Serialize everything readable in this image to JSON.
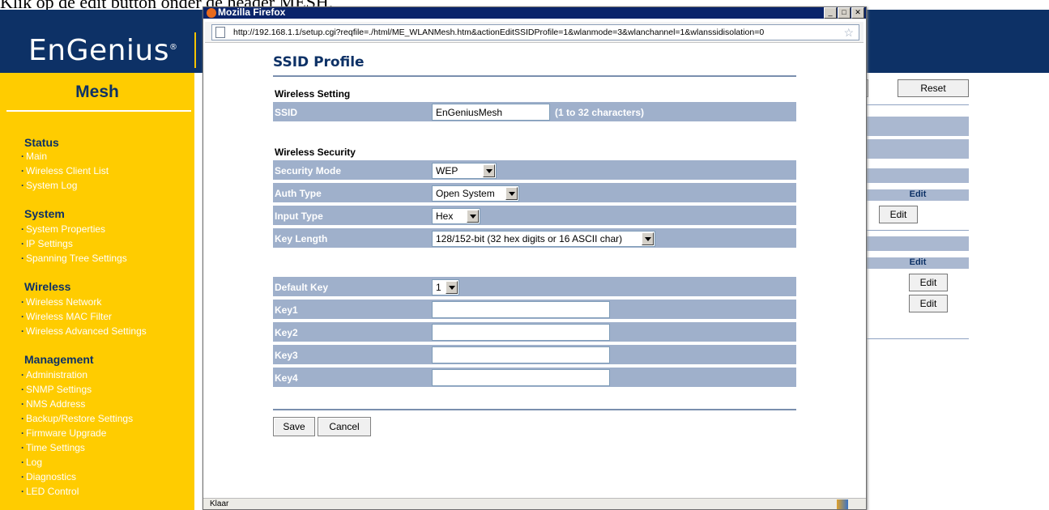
{
  "doc_caption": "Klik op de edit button onder de header MESH.",
  "router": {
    "logo": "EnGenius",
    "logo_mark": "®",
    "sidebar_title": "Mesh",
    "sections": [
      {
        "title": "Status",
        "items": [
          "Main",
          "Wireless Client List",
          "System Log"
        ]
      },
      {
        "title": "System",
        "items": [
          "System Properties",
          "IP Settings",
          "Spanning Tree Settings"
        ]
      },
      {
        "title": "Wireless",
        "items": [
          "Wireless Network",
          "Wireless MAC Filter",
          "Wireless Advanced Settings"
        ]
      },
      {
        "title": "Management",
        "items": [
          "Administration",
          "SNMP Settings",
          "NMS Address",
          "Backup/Restore Settings",
          "Firmware Upgrade",
          "Time Settings",
          "Log",
          "Diagnostics",
          "LED Control"
        ]
      }
    ],
    "bg": {
      "reset_label": "Reset",
      "edit_head_1": "Edit",
      "edit_btn_1": "Edit",
      "edit_head_2": "Edit",
      "edit_btn_2": "Edit",
      "edit_btn_3": "Edit"
    }
  },
  "popup": {
    "window_title": "Mozilla Firefox",
    "url": "http://192.168.1.1/setup.cgi?reqfile=./html/ME_WLANMesh.htm&actionEditSSIDProfile=1&wlanmode=3&wlanchannel=1&wlanssidisolation=0",
    "status": "Klaar",
    "page_title": "SSID Profile",
    "wireless_setting_label": "Wireless Setting",
    "ssid_label": "SSID",
    "ssid_value": "EnGeniusMesh",
    "ssid_hint": "(1 to 32 characters)",
    "wireless_security_label": "Wireless Security",
    "security_mode_label": "Security Mode",
    "security_mode_value": "WEP",
    "auth_type_label": "Auth Type",
    "auth_type_value": "Open System",
    "input_type_label": "Input Type",
    "input_type_value": "Hex",
    "key_length_label": "Key Length",
    "key_length_value": "128/152-bit (32 hex digits or 16 ASCII char)",
    "default_key_label": "Default Key",
    "default_key_value": "1",
    "key1_label": "Key1",
    "key2_label": "Key2",
    "key3_label": "Key3",
    "key4_label": "Key4",
    "key1_value": "",
    "key2_value": "",
    "key3_value": "",
    "key4_value": "",
    "save_label": "Save",
    "cancel_label": "Cancel"
  }
}
